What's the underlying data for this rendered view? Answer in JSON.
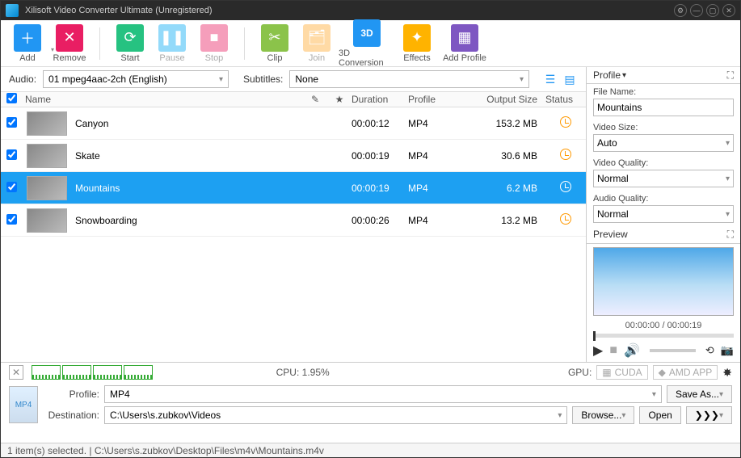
{
  "window": {
    "title": "Xilisoft Video Converter Ultimate (Unregistered)"
  },
  "toolbar": {
    "add": "Add",
    "remove": "Remove",
    "start": "Start",
    "pause": "Pause",
    "stop": "Stop",
    "clip": "Clip",
    "join": "Join",
    "conv3d": "3D Conversion",
    "effects": "Effects",
    "addprofile": "Add Profile"
  },
  "selectors": {
    "audio_label": "Audio:",
    "audio_value": "01 mpeg4aac-2ch (English)",
    "subtitles_label": "Subtitles:",
    "subtitles_value": "None"
  },
  "headers": {
    "name": "Name",
    "star": "★",
    "duration": "Duration",
    "profile": "Profile",
    "output_size": "Output Size",
    "status": "Status",
    "pen": "✎"
  },
  "rows": [
    {
      "name": "Canyon",
      "duration": "00:00:12",
      "profile": "MP4",
      "size": "153.2 MB",
      "selected": false
    },
    {
      "name": "Skate",
      "duration": "00:00:19",
      "profile": "MP4",
      "size": "30.6 MB",
      "selected": false
    },
    {
      "name": "Mountains",
      "duration": "00:00:19",
      "profile": "MP4",
      "size": "6.2 MB",
      "selected": true
    },
    {
      "name": "Snowboarding",
      "duration": "00:00:26",
      "profile": "MP4",
      "size": "13.2 MB",
      "selected": false
    }
  ],
  "profile_panel": {
    "title": "Profile",
    "filename_label": "File Name:",
    "filename_value": "Mountains",
    "videosize_label": "Video Size:",
    "videosize_value": "Auto",
    "videoquality_label": "Video Quality:",
    "videoquality_value": "Normal",
    "audioquality_label": "Audio Quality:",
    "audioquality_value": "Normal"
  },
  "preview": {
    "title": "Preview",
    "time": "00:00:00 / 00:00:19"
  },
  "stats": {
    "cpu": "CPU: 1.95%",
    "gpu_label": "GPU:",
    "cuda": "CUDA",
    "amd": "AMD APP"
  },
  "dest": {
    "profile_label": "Profile:",
    "profile_value": "MP4",
    "destination_label": "Destination:",
    "destination_value": "C:\\Users\\s.zubkov\\Videos",
    "saveas": "Save As...",
    "browse": "Browse...",
    "open": "Open",
    "more": "❯❯❯"
  },
  "statusbar": "1 item(s) selected. | C:\\Users\\s.zubkov\\Desktop\\Files\\m4v\\Mountains.m4v"
}
